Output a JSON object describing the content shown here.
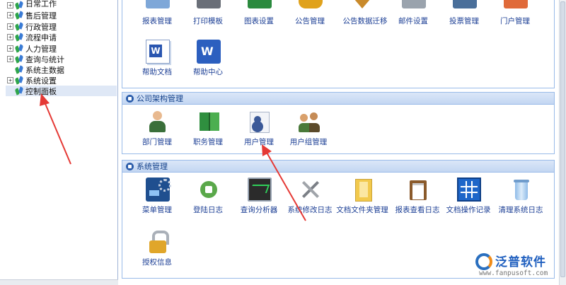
{
  "sidebar": {
    "items": [
      {
        "label": "日常工作",
        "expander": "+"
      },
      {
        "label": "售后管理",
        "expander": "+"
      },
      {
        "label": "行政管理",
        "expander": "+"
      },
      {
        "label": "流程申请",
        "expander": "+"
      },
      {
        "label": "人力管理",
        "expander": "+"
      },
      {
        "label": "查询与统计",
        "expander": "+"
      },
      {
        "label": "系统主数据",
        "expander": ""
      },
      {
        "label": "系统设置",
        "expander": "+"
      },
      {
        "label": "控制面板",
        "expander": "",
        "selected": true
      }
    ]
  },
  "top_panel": {
    "row1": [
      {
        "label": "报表管理",
        "icon": "report-icon"
      },
      {
        "label": "打印模板",
        "icon": "printer-icon"
      },
      {
        "label": "图表设置",
        "icon": "chart-settings-icon"
      },
      {
        "label": "公告管理",
        "icon": "announcement-icon"
      },
      {
        "label": "公告数据迁移",
        "icon": "data-migration-icon"
      },
      {
        "label": "邮件设置",
        "icon": "mail-settings-icon"
      },
      {
        "label": "投票管理",
        "icon": "vote-icon"
      },
      {
        "label": "门户管理",
        "icon": "portal-icon"
      }
    ],
    "row2": [
      {
        "label": "帮助文档",
        "icon": "help-document-icon"
      },
      {
        "label": "帮助中心",
        "icon": "help-center-icon"
      }
    ]
  },
  "org_panel": {
    "title": "公司架构管理",
    "items": [
      {
        "label": "部门管理",
        "icon": "department-icon"
      },
      {
        "label": "职务管理",
        "icon": "position-icon"
      },
      {
        "label": "用户管理",
        "icon": "user-icon"
      },
      {
        "label": "用户组管理",
        "icon": "user-group-icon"
      }
    ]
  },
  "system_panel": {
    "title": "系统管理",
    "items": [
      {
        "label": "菜单管理",
        "icon": "menu-icon"
      },
      {
        "label": "登陆日志",
        "icon": "login-log-icon"
      },
      {
        "label": "查询分析器",
        "icon": "query-analyzer-icon"
      },
      {
        "label": "系统修改日志",
        "icon": "tools-icon"
      },
      {
        "label": "文档文件夹管理",
        "icon": "folder-icon"
      },
      {
        "label": "报表查看日志",
        "icon": "clipboard-icon"
      },
      {
        "label": "文档操作记录",
        "icon": "grid-icon"
      },
      {
        "label": "清理系统日志",
        "icon": "trash-icon"
      }
    ],
    "row2": [
      {
        "label": "授权信息",
        "icon": "lock-icon"
      }
    ]
  },
  "watermark": {
    "name": "泛普软件",
    "url": "www.fanpusoft.com"
  },
  "colors": {
    "accent": "#15428b",
    "annotation_arrow": "#e53935"
  }
}
